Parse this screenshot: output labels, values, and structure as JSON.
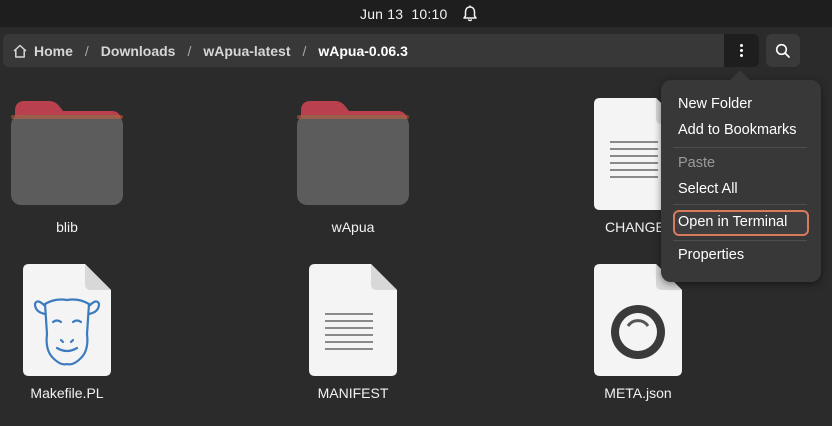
{
  "topbar": {
    "date": "Jun 13",
    "time": "10:10",
    "icons": [
      "bell-icon"
    ]
  },
  "pathbar": {
    "home_icon": "home-icon",
    "crumbs": [
      "Home",
      "Downloads",
      "wApua-latest",
      "wApua-0.06.3"
    ],
    "separator": "/",
    "menu_icon": "vertical-dots-icon",
    "search_icon": "search-icon"
  },
  "files": [
    {
      "name": "blib",
      "kind": "folder"
    },
    {
      "name": "wApua",
      "kind": "folder"
    },
    {
      "name": "CHANGES",
      "kind": "text",
      "visible_label": "CHANGE"
    },
    {
      "name": "Makefile.PL",
      "kind": "perl",
      "icon": "camel-icon"
    },
    {
      "name": "MANIFEST",
      "kind": "text"
    },
    {
      "name": "META.json",
      "kind": "json",
      "icon": "json-icon"
    }
  ],
  "context_menu": {
    "items": [
      {
        "label": "New Folder",
        "enabled": true
      },
      {
        "label": "Add to Bookmarks",
        "enabled": true
      },
      {
        "label": "Paste",
        "enabled": false
      },
      {
        "label": "Select All",
        "enabled": true
      },
      {
        "label": "Open in Terminal",
        "enabled": true,
        "focused": true
      },
      {
        "label": "Properties",
        "enabled": true
      }
    ]
  },
  "colors": {
    "accent_focus": "#d97a5e",
    "folder_tab": "#c64a4a",
    "folder_body": "#5c5c5c",
    "background": "#2b2b2b"
  }
}
